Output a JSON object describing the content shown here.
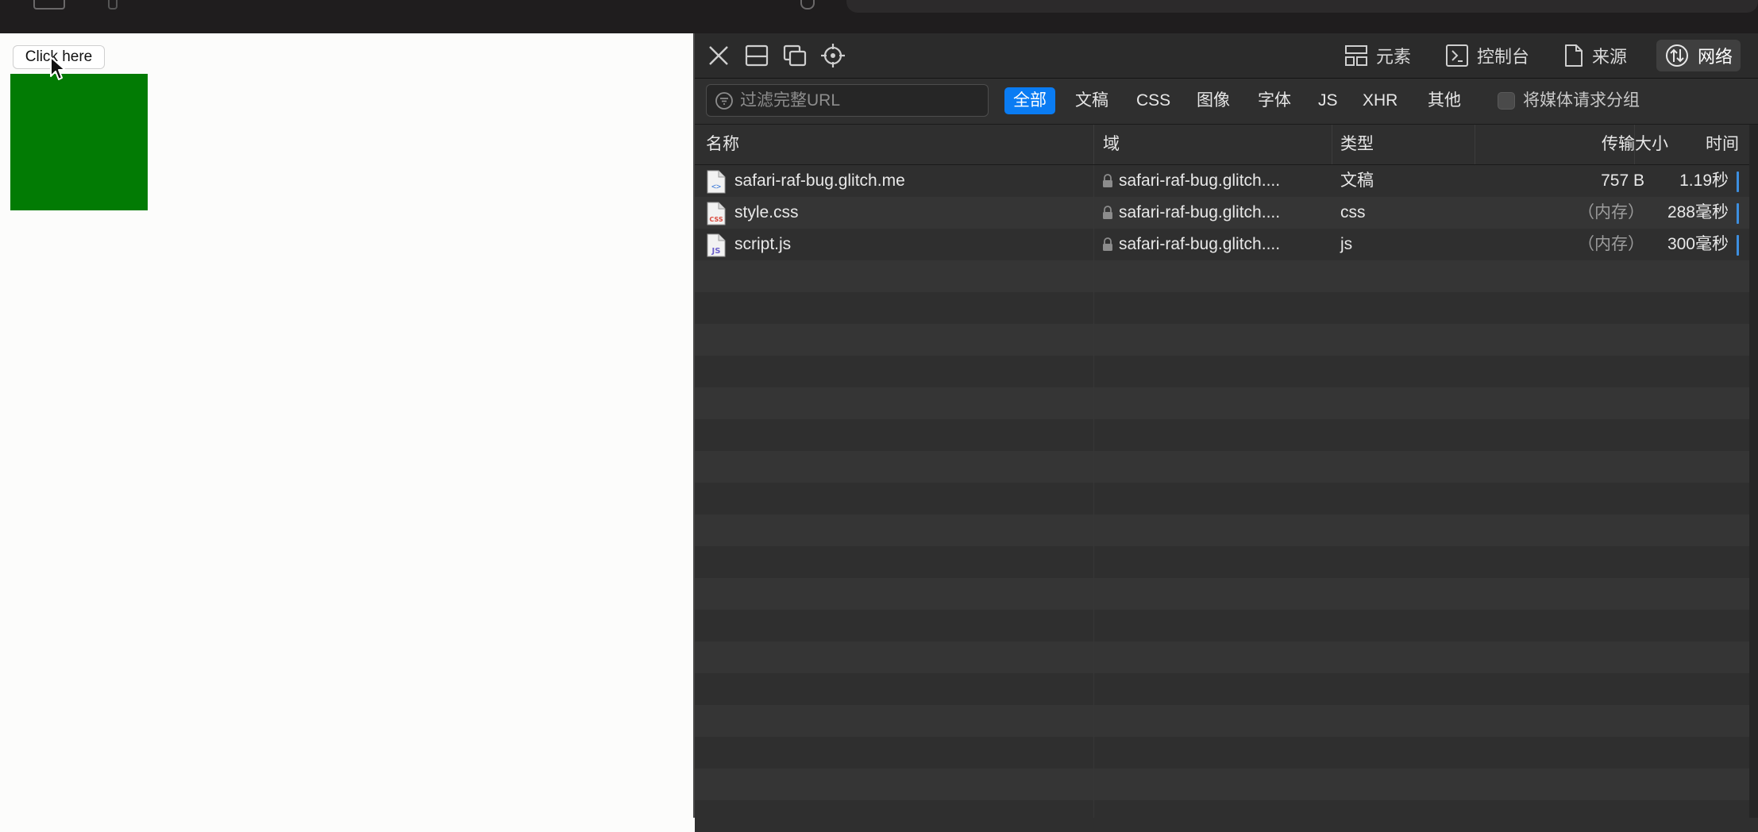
{
  "page": {
    "button_label": "Click here",
    "box_color": "#027b04"
  },
  "devtools": {
    "icons": [
      "close-icon",
      "dock-bottom-icon",
      "dock-separate-window-icon",
      "inspect-element-icon"
    ],
    "tabs": [
      {
        "label": "元素",
        "icon": "elements-icon",
        "active": false
      },
      {
        "label": "控制台",
        "icon": "console-icon",
        "active": false
      },
      {
        "label": "来源",
        "icon": "sources-icon",
        "active": false
      },
      {
        "label": "网络",
        "icon": "network-icon",
        "active": true
      }
    ],
    "filter": {
      "placeholder": "过滤完整URL",
      "types": [
        "全部",
        "文稿",
        "CSS",
        "图像",
        "字体",
        "JS",
        "XHR",
        "其他"
      ],
      "active_type": "全部",
      "group_media_label": "将媒体请求分组",
      "group_media_checked": false
    },
    "table": {
      "columns": [
        "名称",
        "域",
        "类型",
        "传输大小",
        "时间"
      ],
      "rows": [
        {
          "name": "safari-raf-bug.glitch.me",
          "icon": "document-file-icon",
          "domain": "safari-raf-bug.glitch....",
          "type": "文稿",
          "size": "757 B",
          "time": "1.19秒"
        },
        {
          "name": "style.css",
          "icon": "css-file-icon",
          "domain": "safari-raf-bug.glitch....",
          "type": "css",
          "size": "（内存）",
          "time": "288毫秒"
        },
        {
          "name": "script.js",
          "icon": "js-file-icon",
          "domain": "safari-raf-bug.glitch....",
          "type": "js",
          "size": "（内存）",
          "time": "300毫秒"
        }
      ]
    },
    "accent_color": "#0a7cf3"
  }
}
